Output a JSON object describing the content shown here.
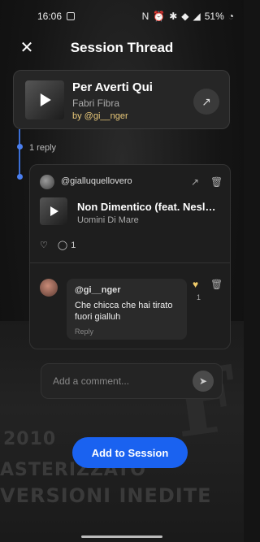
{
  "status_bar": {
    "time": "16:06",
    "battery": "51%"
  },
  "header": {
    "title": "Session Thread",
    "close_icon": "close-icon"
  },
  "main_track": {
    "title": "Per Averti Qui",
    "artist": "Fabri Fibra",
    "by": "by @gi__nger"
  },
  "thread": {
    "reply_count": "1 reply"
  },
  "reply": {
    "user": "@gialluquellovero",
    "track_title": "Non Dimentico (feat. Nesly Ri...",
    "track_artist": "Uomini Di Mare",
    "comment_count": "1"
  },
  "comment": {
    "user": "@gi__nger",
    "text": "Che chicca che hai tirato fuori gialluh",
    "reply_label": "Reply",
    "like_count": "1"
  },
  "comment_input": {
    "placeholder": "Add a comment..."
  },
  "actions": {
    "add_to_session": "Add to Session"
  },
  "background_art": {
    "line1": "2010",
    "line2": "ASTERIZZATO",
    "line3": "VERSIONI INEDITE"
  },
  "colors": {
    "accent": "#1a62f0",
    "thread": "#3b6fd6",
    "by_line": "#e8c879"
  }
}
